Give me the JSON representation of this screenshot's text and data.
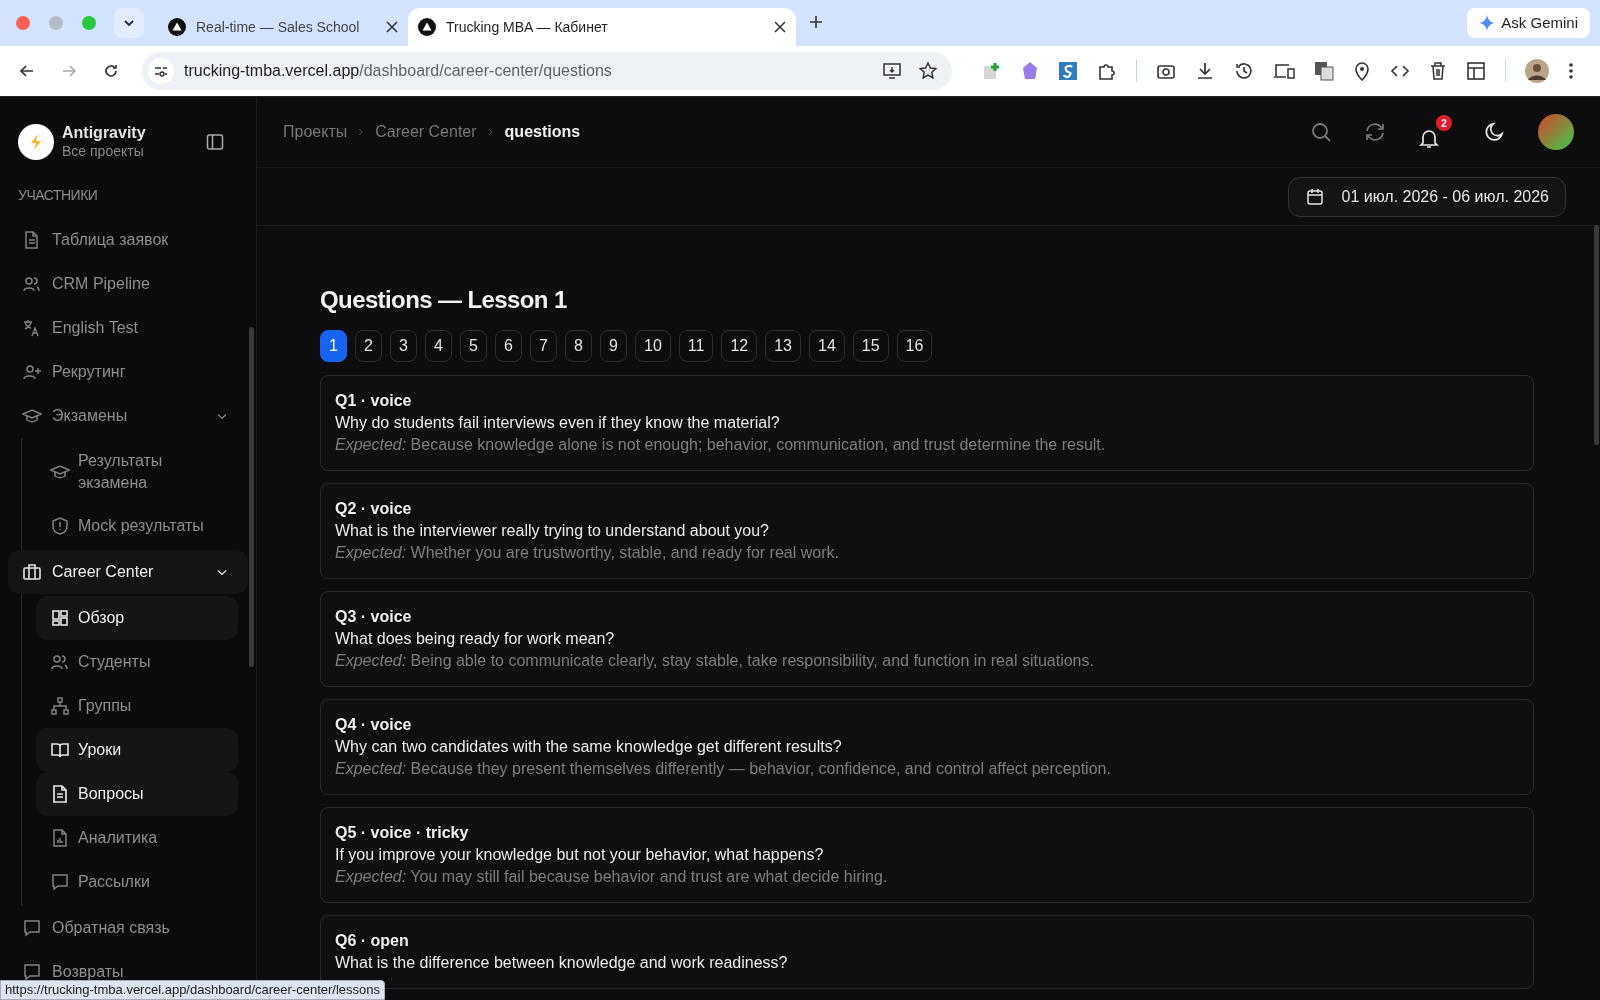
{
  "browser": {
    "tabs": [
      {
        "title": "Real-time — Sales School",
        "selected": false
      },
      {
        "title": "Trucking MBA — Кабинет",
        "selected": true
      }
    ],
    "address": {
      "host": "trucking-tmba.vercel.app",
      "path": "/dashboard/career-center/questions"
    },
    "gemini_button": "Ask Gemini",
    "status_url": "https://trucking-tmba.vercel.app/dashboard/career-center/lessons"
  },
  "sidebar": {
    "workspace": {
      "name": "Antigravity",
      "subtitle": "Все проекты"
    },
    "section": "УЧАСТНИКИ",
    "items": [
      {
        "label": "Таблица заявок",
        "selected": false
      },
      {
        "label": "CRM Pipeline",
        "selected": false
      },
      {
        "label": "English Test",
        "selected": false
      },
      {
        "label": "Рекрутинг",
        "selected": false
      },
      {
        "label": "Экзамены",
        "selected": false,
        "expanded": true,
        "children": [
          {
            "label": "Результаты экзамена",
            "selected": false
          },
          {
            "label": "Mock результаты",
            "selected": false
          }
        ]
      },
      {
        "label": "Career Center",
        "selected": true,
        "expanded": true,
        "children": [
          {
            "label": "Обзор",
            "selected": true
          },
          {
            "label": "Студенты",
            "selected": false
          },
          {
            "label": "Группы",
            "selected": false
          },
          {
            "label": "Уроки",
            "selected": true
          },
          {
            "label": "Вопросы",
            "selected": true
          },
          {
            "label": "Аналитика",
            "selected": false
          },
          {
            "label": "Рассылки",
            "selected": false
          }
        ]
      },
      {
        "label": "Обратная связь",
        "selected": false
      },
      {
        "label": "Возвраты",
        "selected": false
      }
    ]
  },
  "header": {
    "breadcrumbs": [
      "Проекты",
      "Career Center",
      "questions"
    ],
    "notification_count": "2",
    "date_range": "01 июл. 2026 - 06 июл. 2026"
  },
  "content": {
    "title": "Questions — Lesson 1",
    "pages": [
      {
        "label": "1",
        "selected": true
      },
      {
        "label": "2",
        "selected": false
      },
      {
        "label": "3",
        "selected": false
      },
      {
        "label": "4",
        "selected": false
      },
      {
        "label": "5",
        "selected": false
      },
      {
        "label": "6",
        "selected": false
      },
      {
        "label": "7",
        "selected": false
      },
      {
        "label": "8",
        "selected": false
      },
      {
        "label": "9",
        "selected": false
      },
      {
        "label": "10",
        "selected": false
      },
      {
        "label": "11",
        "selected": false
      },
      {
        "label": "12",
        "selected": false
      },
      {
        "label": "13",
        "selected": false
      },
      {
        "label": "14",
        "selected": false
      },
      {
        "label": "15",
        "selected": false
      },
      {
        "label": "16",
        "selected": false
      }
    ],
    "questions": [
      {
        "label": "Q1 · voice",
        "question": "Why do students fail interviews even if they know the material?",
        "expected": "*Expected:* Because knowledge alone is not enough; behavior, communication, and trust determine the result."
      },
      {
        "label": "Q2 · voice",
        "question": "What is the interviewer really trying to understand about you?",
        "expected": "*Expected:* Whether you are trustworthy, stable, and ready for real work."
      },
      {
        "label": "Q3 · voice",
        "question": "What does being ready for work mean?",
        "expected": "*Expected:* Being able to communicate clearly, stay stable, take responsibility, and function in real situations."
      },
      {
        "label": "Q4 · voice",
        "question": "Why can two candidates with the same knowledge get different results?",
        "expected": "*Expected:* Because they present themselves differently — behavior, confidence, and control affect perception."
      },
      {
        "label": "Q5 · voice · tricky",
        "question": "If you improve your knowledge but not your behavior, what happens?",
        "expected": "*Expected:* You may still fail because behavior and trust are what decide hiring."
      },
      {
        "label": "Q6 · open",
        "question": "What is the difference between knowledge and work readiness?"
      }
    ]
  }
}
